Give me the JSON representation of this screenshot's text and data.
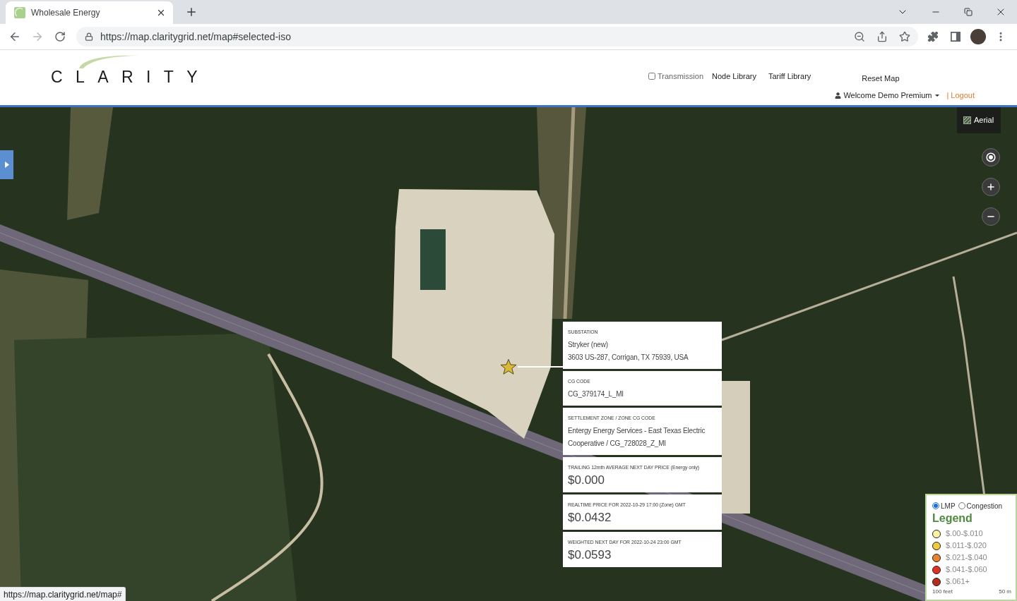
{
  "browser": {
    "tab": {
      "title": "Wholesale Energy"
    },
    "address_bar": {
      "url": "https://map.claritygrid.net/map#selected-iso"
    }
  },
  "header": {
    "logo": "CLARITY",
    "transmission": {
      "label": "Transmission",
      "checked": false
    },
    "nav_links": [
      "Node Library",
      "Tariff Library"
    ],
    "reset_map": "Reset Map",
    "user_menu": "Welcome Demo Premium",
    "separator": "|",
    "logout": "Logout"
  },
  "map": {
    "layer_button": "Aerial",
    "popup": {
      "sections": [
        {
          "kind": "text",
          "label": "SUBSTATION",
          "lines": [
            "Stryker (new)",
            "3603 US-287, Corrigan, TX 75939, USA"
          ]
        },
        {
          "kind": "text",
          "label": "CG CODE",
          "lines": [
            "CG_379174_L_MI"
          ]
        },
        {
          "kind": "text",
          "label": "SETTLEMENT ZONE / ZONE CG CODE",
          "lines": [
            "Entergy Energy Services - East Texas Electric Cooperative / CG_728028_Z_MI"
          ]
        },
        {
          "kind": "price",
          "label": "TRAILING 12mth AVERAGE NEXT DAY PRICE (Energy only)",
          "lines": [
            "$0.000"
          ]
        },
        {
          "kind": "price",
          "label": "REALTIME PRICE FOR 2022-10-29 17:00 (Zone) GMT",
          "lines": [
            "$0.0432"
          ]
        },
        {
          "kind": "price",
          "label": "WEIGHTED NEXT DAY FOR 2022-10-24 23:00 GMT",
          "lines": [
            "$0.0593"
          ]
        }
      ]
    },
    "legend": {
      "modes": [
        {
          "label": "LMP",
          "selected": true
        },
        {
          "label": "Congestion",
          "selected": false
        }
      ],
      "title": "Legend",
      "items": [
        {
          "label": "$.00-$.010",
          "color": "#fdf4a3"
        },
        {
          "label": "$.011-$.020",
          "color": "#f3c843"
        },
        {
          "label": "$.021-$.040",
          "color": "#e8842f"
        },
        {
          "label": "$.041-$.060",
          "color": "#df3322"
        },
        {
          "label": "$.061+",
          "color": "#b52d1c"
        }
      ],
      "scale": [
        "100 feet",
        "50 m"
      ]
    }
  },
  "status_bar": {
    "url": "https://map.claritygrid.net/map#"
  }
}
